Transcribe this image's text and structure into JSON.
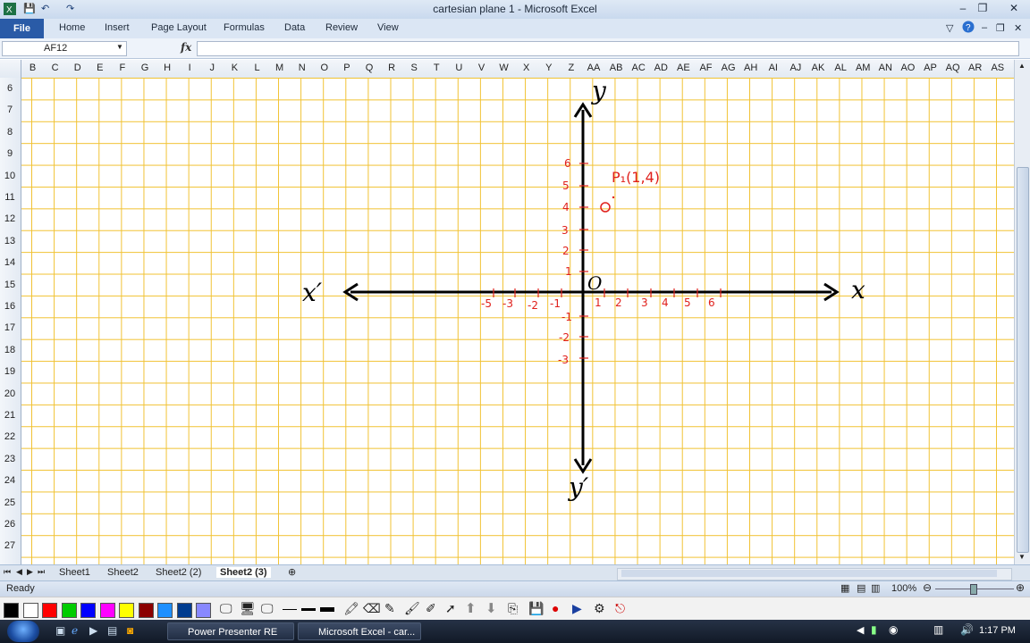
{
  "window": {
    "title": "cartesian plane 1  -  Microsoft Excel"
  },
  "ribbon": {
    "tabs": [
      "File",
      "Home",
      "Insert",
      "Page Layout",
      "Formulas",
      "Data",
      "Review",
      "View"
    ]
  },
  "formula_bar": {
    "name_box": "AF12",
    "fx": "fx",
    "value": ""
  },
  "columns": [
    "B",
    "C",
    "D",
    "E",
    "F",
    "G",
    "H",
    "I",
    "J",
    "K",
    "L",
    "M",
    "N",
    "O",
    "P",
    "Q",
    "R",
    "S",
    "T",
    "U",
    "V",
    "W",
    "X",
    "Y",
    "Z",
    "AA",
    "AB",
    "AC",
    "AD",
    "AE",
    "AF",
    "AG",
    "AH",
    "AI",
    "AJ",
    "AK",
    "AL",
    "AM",
    "AN",
    "AO",
    "AP",
    "AQ",
    "AR",
    "AS"
  ],
  "rows": [
    "6",
    "7",
    "8",
    "9",
    "10",
    "11",
    "12",
    "13",
    "14",
    "15",
    "16",
    "17",
    "18",
    "19",
    "20",
    "21",
    "22",
    "23",
    "24",
    "25",
    "26",
    "27"
  ],
  "drawing": {
    "axis_labels": {
      "x": "x",
      "x_prime": "x′",
      "y": "y",
      "y_prime": "y′",
      "origin": "O"
    },
    "x_tick_labels_pos": [
      "1",
      "2",
      "3",
      "4",
      "5",
      "6"
    ],
    "x_tick_labels_neg": [
      "-5",
      "-3",
      "-2",
      "-1"
    ],
    "y_tick_labels_pos": [
      "1",
      "2",
      "3",
      "4",
      "5",
      "6"
    ],
    "y_tick_labels_neg": [
      "-1",
      "-2",
      "-3"
    ],
    "point_label": "P₁(1,4)",
    "ink_color": "#e0201b",
    "axis_color": "#000000"
  },
  "sheet_tabs": [
    "Sheet1",
    "Sheet2",
    "Sheet2 (2)",
    "Sheet2 (3)"
  ],
  "active_sheet": "Sheet2 (3)",
  "status": {
    "ready": "Ready",
    "zoom": "100%"
  },
  "presenter_colors": [
    "#000000",
    "#ffffff",
    "#ff0000",
    "#00cc00",
    "#0000ff",
    "#ff00ff",
    "#ffff00",
    "#8b0000",
    "#1e90ff",
    "#003c8f",
    "#8888ff"
  ],
  "taskbar": {
    "items": [
      "Power Presenter RE",
      "Microsoft Excel - car..."
    ],
    "clock": "1:17 PM"
  }
}
